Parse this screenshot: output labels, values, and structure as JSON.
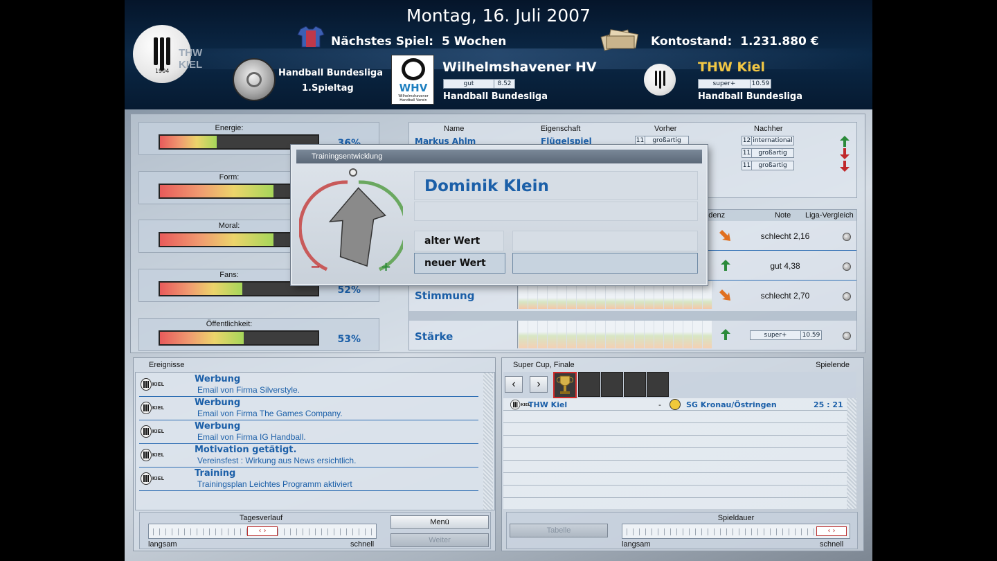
{
  "header": {
    "date": "Montag, 16. Juli 2007",
    "next_game_label": "Nächstes Spiel:",
    "next_game_value": "5 Wochen",
    "balance_label": "Kontostand:",
    "balance_value": "1.231.880 €",
    "club_logo_year": "1904",
    "club_logo_text": "THW KIEL",
    "competition": "Handball Bundesliga",
    "matchday": "1.Spieltag",
    "opponent": {
      "name": "Wilhelmshavener HV",
      "logo_text": "WHV",
      "logo_sub": "Wilhelmshavener Handball Verein",
      "rating_label": "gut",
      "rating_value": "8.52",
      "league": "Handball Bundesliga"
    },
    "own": {
      "name": "THW Kiel",
      "rating_label": "super+",
      "rating_value": "10.59",
      "league": "Handball Bundesliga"
    }
  },
  "stats": [
    {
      "label": "Energie:",
      "percent": "36%",
      "value": 36
    },
    {
      "label": "Form:",
      "percent": "",
      "value": 72
    },
    {
      "label": "Moral:",
      "percent": "",
      "value": 72
    },
    {
      "label": "Fans:",
      "percent": "52%",
      "value": 52
    },
    {
      "label": "Öffentlichkeit:",
      "percent": "53%",
      "value": 53
    }
  ],
  "training_table": {
    "headers": [
      "Name",
      "Eigenschaft",
      "Vorher",
      "Nachher"
    ],
    "rows": [
      {
        "name": "Markus Ahlm",
        "attribute": "Flügelspiel",
        "before_num": "11",
        "before_label": "großartig",
        "after_num": "12",
        "after_label": "international",
        "trend": "up"
      },
      {
        "name": "",
        "attribute": "",
        "before_num": "",
        "before_label": "",
        "after_num": "11",
        "after_label": "großartig",
        "trend": "down"
      },
      {
        "name": "",
        "attribute": "",
        "before_num": "",
        "before_label": "",
        "after_num": "11",
        "after_label": "großartig",
        "trend": "down"
      }
    ]
  },
  "team_table": {
    "headers": [
      "endenz",
      "Note",
      "Liga-Vergleich"
    ],
    "rows": [
      {
        "label": "",
        "trend": "down-right",
        "note": "schlecht 2,16"
      },
      {
        "label": "",
        "trend": "up",
        "note": "gut 4,38"
      },
      {
        "label": "Stimmung",
        "trend": "down-right",
        "note": "schlecht 2,70"
      },
      {
        "label": "Stärke",
        "trend": "up",
        "note_label": "super+",
        "note_value": "10.59"
      }
    ]
  },
  "modal": {
    "title": "Trainingsentwicklung",
    "player": "Dominik Klein",
    "old_value_label": "alter Wert",
    "new_value_label": "neuer Wert",
    "minus": "−",
    "plus": "+"
  },
  "events": {
    "title": "Ereignisse",
    "items": [
      {
        "title": "Werbung",
        "desc": "Email von Firma Silverstyle."
      },
      {
        "title": "Werbung",
        "desc": "Email von Firma The Games Company."
      },
      {
        "title": "Werbung",
        "desc": "Email von Firma IG Handball."
      },
      {
        "title": "Motivation getätigt.",
        "desc": "Vereinsfest : Wirkung aus News ersichtlich."
      },
      {
        "title": "Training",
        "desc": "Trainingsplan Leichtes Programm aktiviert"
      }
    ]
  },
  "day_control": {
    "label": "Tagesverlauf",
    "slow": "langsam",
    "fast": "schnell",
    "menu": "Menü",
    "next": "Weiter"
  },
  "match": {
    "title": "Super Cup, Finale",
    "status": "Spielende",
    "home": "THW Kiel",
    "separator": "-",
    "away": "SG Kronau/Östringen",
    "score": "25 : 21"
  },
  "match_control": {
    "table_btn": "Tabelle",
    "label": "Spieldauer",
    "slow": "langsam",
    "fast": "schnell"
  },
  "colors": {
    "accent_blue": "#1b5fa8",
    "gold": "#f2c744",
    "arrow_green": "#2b8a3a",
    "arrow_red": "#c0282b",
    "arrow_orange": "#e07020"
  }
}
